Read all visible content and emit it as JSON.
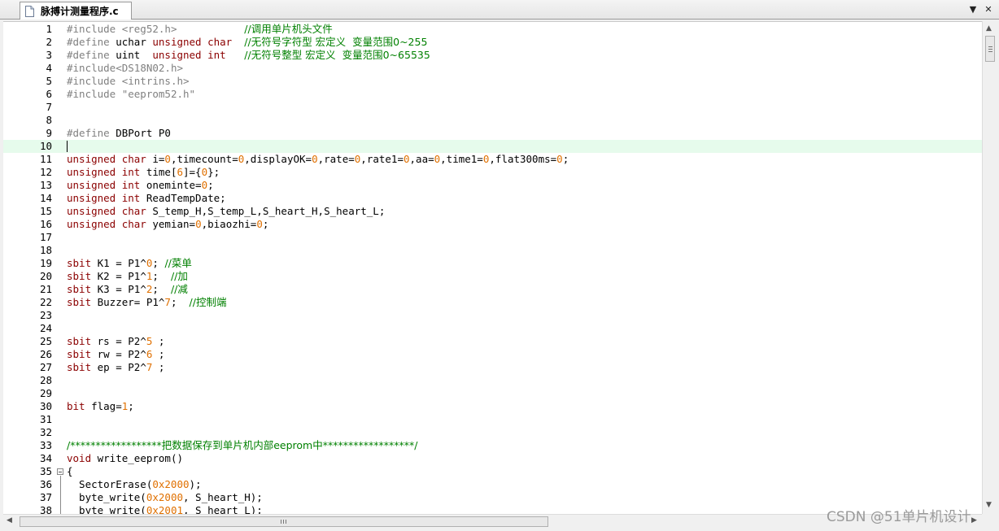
{
  "tab": {
    "label": "脉搏计测量程序.c"
  },
  "toolbar": {
    "dropdown_glyph": "▼",
    "close_glyph": "✕"
  },
  "scroll": {
    "up_glyph": "▲",
    "down_glyph": "▼",
    "left_glyph": "◀",
    "right_glyph": "▶"
  },
  "editor": {
    "current_line": 10
  },
  "lines": [
    {
      "n": "1",
      "t": [
        [
          "pp",
          "#include "
        ],
        [
          "str",
          "<reg52.h>"
        ],
        [
          "id",
          "           "
        ],
        [
          "cm",
          "//调用单片机头文件"
        ]
      ]
    },
    {
      "n": "2",
      "t": [
        [
          "pp",
          "#define "
        ],
        [
          "id",
          "uchar "
        ],
        [
          "ty",
          "unsigned char"
        ],
        [
          "id",
          "  "
        ],
        [
          "cm",
          "//无符号字符型 宏定义  变量范围0~255"
        ]
      ]
    },
    {
      "n": "3",
      "t": [
        [
          "pp",
          "#define "
        ],
        [
          "id",
          "uint  "
        ],
        [
          "ty",
          "unsigned int"
        ],
        [
          "id",
          "   "
        ],
        [
          "cm",
          "//无符号整型 宏定义  变量范围0~65535"
        ]
      ]
    },
    {
      "n": "4",
      "t": [
        [
          "pp",
          "#include"
        ],
        [
          "str",
          "<DS18N02.h>"
        ]
      ]
    },
    {
      "n": "5",
      "t": [
        [
          "pp",
          "#include "
        ],
        [
          "str",
          "<intrins.h>"
        ]
      ]
    },
    {
      "n": "6",
      "t": [
        [
          "pp",
          "#include "
        ],
        [
          "str",
          "\"eeprom52.h\""
        ]
      ]
    },
    {
      "n": "7",
      "t": []
    },
    {
      "n": "8",
      "t": []
    },
    {
      "n": "9",
      "t": [
        [
          "pp",
          "#define "
        ],
        [
          "id",
          "DBPort P0"
        ]
      ]
    },
    {
      "n": "10",
      "t": []
    },
    {
      "n": "11",
      "t": [
        [
          "ty",
          "unsigned char"
        ],
        [
          "id",
          " i="
        ],
        [
          "num",
          "0"
        ],
        [
          "id",
          ",timecount="
        ],
        [
          "num",
          "0"
        ],
        [
          "id",
          ",displayOK="
        ],
        [
          "num",
          "0"
        ],
        [
          "id",
          ",rate="
        ],
        [
          "num",
          "0"
        ],
        [
          "id",
          ",rate1="
        ],
        [
          "num",
          "0"
        ],
        [
          "id",
          ",aa="
        ],
        [
          "num",
          "0"
        ],
        [
          "id",
          ",time1="
        ],
        [
          "num",
          "0"
        ],
        [
          "id",
          ",flat300ms="
        ],
        [
          "num",
          "0"
        ],
        [
          "id",
          ";"
        ]
      ]
    },
    {
      "n": "12",
      "t": [
        [
          "ty",
          "unsigned int"
        ],
        [
          "id",
          " time["
        ],
        [
          "num",
          "6"
        ],
        [
          "id",
          "]={"
        ],
        [
          "num",
          "0"
        ],
        [
          "id",
          "};"
        ]
      ]
    },
    {
      "n": "13",
      "t": [
        [
          "ty",
          "unsigned int"
        ],
        [
          "id",
          " oneminte="
        ],
        [
          "num",
          "0"
        ],
        [
          "id",
          ";"
        ]
      ]
    },
    {
      "n": "14",
      "t": [
        [
          "ty",
          "unsigned int"
        ],
        [
          "id",
          " ReadTempDate;"
        ]
      ]
    },
    {
      "n": "15",
      "t": [
        [
          "ty",
          "unsigned char"
        ],
        [
          "id",
          " S_temp_H,S_temp_L,S_heart_H,S_heart_L;"
        ]
      ]
    },
    {
      "n": "16",
      "t": [
        [
          "ty",
          "unsigned char"
        ],
        [
          "id",
          " yemian="
        ],
        [
          "num",
          "0"
        ],
        [
          "id",
          ",biaozhi="
        ],
        [
          "num",
          "0"
        ],
        [
          "id",
          ";"
        ]
      ]
    },
    {
      "n": "17",
      "t": []
    },
    {
      "n": "18",
      "t": []
    },
    {
      "n": "19",
      "t": [
        [
          "kw",
          "sbit"
        ],
        [
          "id",
          " K1 = P1^"
        ],
        [
          "num",
          "0"
        ],
        [
          "id",
          "; "
        ],
        [
          "cm",
          "//菜单"
        ]
      ]
    },
    {
      "n": "20",
      "t": [
        [
          "kw",
          "sbit"
        ],
        [
          "id",
          " K2 = P1^"
        ],
        [
          "num",
          "1"
        ],
        [
          "id",
          ";  "
        ],
        [
          "cm",
          "//加"
        ]
      ]
    },
    {
      "n": "21",
      "t": [
        [
          "kw",
          "sbit"
        ],
        [
          "id",
          " K3 = P1^"
        ],
        [
          "num",
          "2"
        ],
        [
          "id",
          ";  "
        ],
        [
          "cm",
          "//减"
        ]
      ]
    },
    {
      "n": "22",
      "t": [
        [
          "kw",
          "sbit"
        ],
        [
          "id",
          " Buzzer= P1^"
        ],
        [
          "num",
          "7"
        ],
        [
          "id",
          ";  "
        ],
        [
          "cm",
          "//控制端"
        ]
      ]
    },
    {
      "n": "23",
      "t": []
    },
    {
      "n": "24",
      "t": []
    },
    {
      "n": "25",
      "t": [
        [
          "kw",
          "sbit"
        ],
        [
          "id",
          " rs = P2^"
        ],
        [
          "num",
          "5"
        ],
        [
          "id",
          " ;"
        ]
      ]
    },
    {
      "n": "26",
      "t": [
        [
          "kw",
          "sbit"
        ],
        [
          "id",
          " rw = P2^"
        ],
        [
          "num",
          "6"
        ],
        [
          "id",
          " ;"
        ]
      ]
    },
    {
      "n": "27",
      "t": [
        [
          "kw",
          "sbit"
        ],
        [
          "id",
          " ep = P2^"
        ],
        [
          "num",
          "7"
        ],
        [
          "id",
          " ;"
        ]
      ]
    },
    {
      "n": "28",
      "t": []
    },
    {
      "n": "29",
      "t": []
    },
    {
      "n": "30",
      "t": [
        [
          "kw",
          "bit"
        ],
        [
          "id",
          " flag="
        ],
        [
          "num",
          "1"
        ],
        [
          "id",
          ";"
        ]
      ]
    },
    {
      "n": "31",
      "t": []
    },
    {
      "n": "32",
      "t": []
    },
    {
      "n": "33",
      "t": [
        [
          "cm",
          "/******************把数据保存到单片机内部eeprom中******************/"
        ]
      ]
    },
    {
      "n": "34",
      "t": [
        [
          "kw",
          "void"
        ],
        [
          "id",
          " write_eeprom()"
        ]
      ]
    },
    {
      "n": "35",
      "t": [
        [
          "id",
          "{"
        ]
      ],
      "fold": true
    },
    {
      "n": "36",
      "t": [
        [
          "id",
          "  SectorErase("
        ],
        [
          "num",
          "0x2000"
        ],
        [
          "id",
          ");"
        ]
      ]
    },
    {
      "n": "37",
      "t": [
        [
          "id",
          "  byte_write("
        ],
        [
          "num",
          "0x2000"
        ],
        [
          "id",
          ", S_heart_H);"
        ]
      ]
    },
    {
      "n": "38",
      "t": [
        [
          "id",
          "  byte_write("
        ],
        [
          "num",
          "0x2001"
        ],
        [
          "id",
          ", S_heart_L);"
        ]
      ]
    }
  ],
  "watermark": "CSDN @51单片机设计"
}
